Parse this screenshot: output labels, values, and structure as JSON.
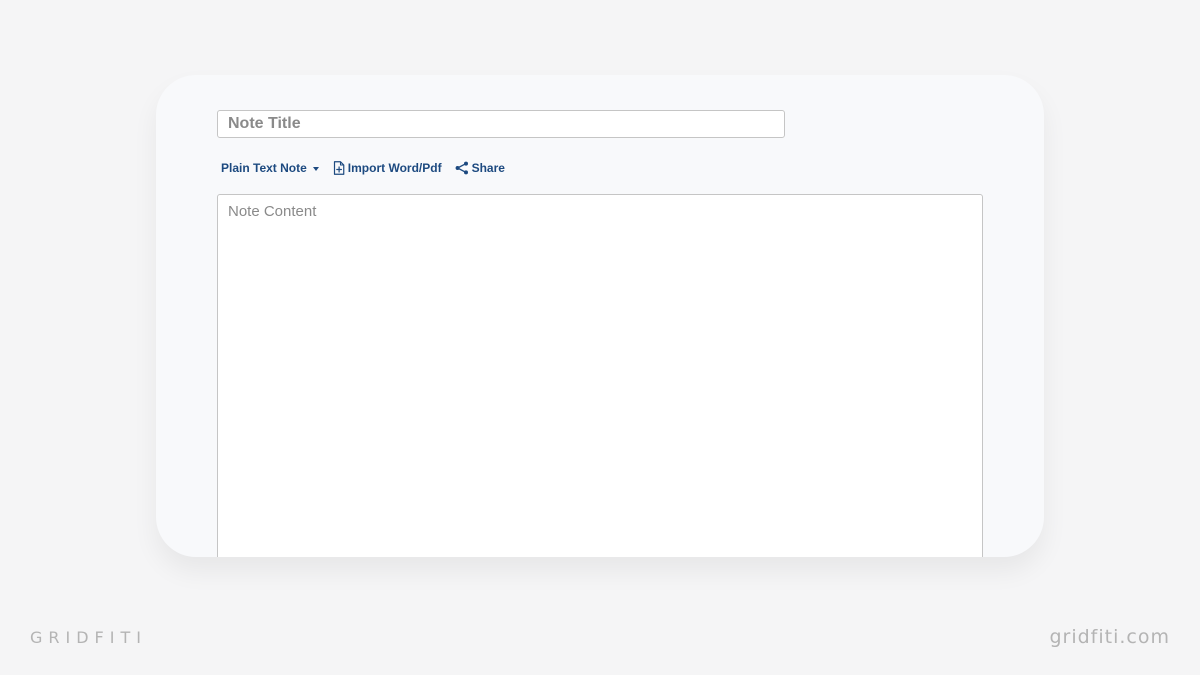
{
  "editor": {
    "title_placeholder": "Note Title",
    "content_placeholder": "Note Content"
  },
  "toolbar": {
    "note_type_label": "Plain Text Note",
    "import_label": "Import Word/Pdf",
    "share_label": "Share"
  },
  "icons": {
    "note_type": "chevron-down-icon",
    "import": "document-import-icon",
    "share": "share-icon"
  },
  "colors": {
    "page_background": "#f5f5f6",
    "card_background": "#f8f9fb",
    "link": "#1d4a80",
    "input_border": "#c5c5c5",
    "placeholder": "#8a8a8a",
    "watermark": "#b4b4b4"
  },
  "watermark": {
    "left": "GRIDFITI",
    "right": "gridfiti.com"
  }
}
